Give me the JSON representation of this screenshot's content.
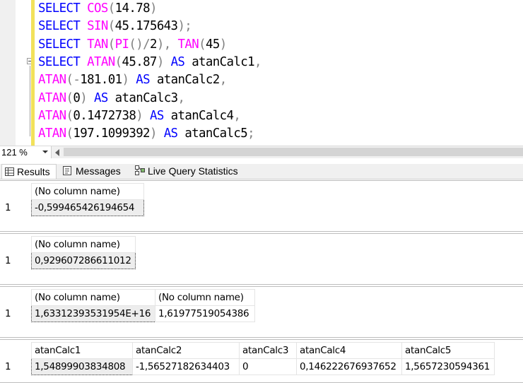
{
  "editor": {
    "lines": [
      [
        {
          "t": "SELECT ",
          "c": "kw"
        },
        {
          "t": "COS",
          "c": "fn"
        },
        {
          "t": "(",
          "c": "op"
        },
        {
          "t": "14.78",
          "c": "tx"
        },
        {
          "t": ")",
          "c": "op"
        }
      ],
      [
        {
          "t": "SELECT ",
          "c": "kw"
        },
        {
          "t": "SIN",
          "c": "fn"
        },
        {
          "t": "(",
          "c": "op"
        },
        {
          "t": "45.175643",
          "c": "tx"
        },
        {
          "t": ");",
          "c": "op"
        }
      ],
      [
        {
          "t": "SELECT ",
          "c": "kw"
        },
        {
          "t": "TAN",
          "c": "fn"
        },
        {
          "t": "(",
          "c": "op"
        },
        {
          "t": "PI",
          "c": "fn"
        },
        {
          "t": "()/",
          "c": "op"
        },
        {
          "t": "2",
          "c": "tx"
        },
        {
          "t": "), ",
          "c": "op"
        },
        {
          "t": "TAN",
          "c": "fn"
        },
        {
          "t": "(",
          "c": "op"
        },
        {
          "t": "45",
          "c": "tx"
        },
        {
          "t": ")",
          "c": "op"
        }
      ],
      [
        {
          "t": "SELECT ",
          "c": "kw"
        },
        {
          "t": "ATAN",
          "c": "fn"
        },
        {
          "t": "(",
          "c": "op"
        },
        {
          "t": "45.87",
          "c": "tx"
        },
        {
          "t": ") ",
          "c": "op"
        },
        {
          "t": "AS ",
          "c": "kw"
        },
        {
          "t": "atanCalc1",
          "c": "tx"
        },
        {
          "t": ",",
          "c": "op"
        }
      ],
      [
        {
          "t": "ATAN",
          "c": "fn"
        },
        {
          "t": "(-",
          "c": "op"
        },
        {
          "t": "181.01",
          "c": "tx"
        },
        {
          "t": ") ",
          "c": "op"
        },
        {
          "t": "AS ",
          "c": "kw"
        },
        {
          "t": "atanCalc2",
          "c": "tx"
        },
        {
          "t": ",",
          "c": "op"
        }
      ],
      [
        {
          "t": "ATAN",
          "c": "fn"
        },
        {
          "t": "(",
          "c": "op"
        },
        {
          "t": "0",
          "c": "tx"
        },
        {
          "t": ") ",
          "c": "op"
        },
        {
          "t": "AS ",
          "c": "kw"
        },
        {
          "t": "atanCalc3",
          "c": "tx"
        },
        {
          "t": ",",
          "c": "op"
        }
      ],
      [
        {
          "t": "ATAN",
          "c": "fn"
        },
        {
          "t": "(",
          "c": "op"
        },
        {
          "t": "0.1472738",
          "c": "tx"
        },
        {
          "t": ") ",
          "c": "op"
        },
        {
          "t": "AS ",
          "c": "kw"
        },
        {
          "t": "atanCalc4",
          "c": "tx"
        },
        {
          "t": ",",
          "c": "op"
        }
      ],
      [
        {
          "t": "ATAN",
          "c": "fn"
        },
        {
          "t": "(",
          "c": "op"
        },
        {
          "t": "197.1099392",
          "c": "tx"
        },
        {
          "t": ") ",
          "c": "op"
        },
        {
          "t": "AS ",
          "c": "kw"
        },
        {
          "t": "atanCalc5",
          "c": "tx"
        },
        {
          "t": ";",
          "c": "op"
        }
      ]
    ]
  },
  "zoom": {
    "value": "121 %"
  },
  "tabs": {
    "results": "Results",
    "messages": "Messages",
    "live": "Live Query Statistics"
  },
  "results": [
    {
      "headers": [
        "(No column name)"
      ],
      "rows": [
        {
          "num": "1",
          "cells": [
            "-0,599465426194654"
          ]
        }
      ]
    },
    {
      "headers": [
        "(No column name)"
      ],
      "rows": [
        {
          "num": "1",
          "cells": [
            "0,929607286611012"
          ]
        }
      ]
    },
    {
      "headers": [
        "(No column name)",
        "(No column name)"
      ],
      "rows": [
        {
          "num": "1",
          "cells": [
            "1,63312393531954E+16",
            "1,61977519054386"
          ]
        }
      ]
    },
    {
      "headers": [
        "atanCalc1",
        "atanCalc2",
        "atanCalc3",
        "atanCalc4",
        "atanCalc5"
      ],
      "rows": [
        {
          "num": "1",
          "cells": [
            "1,54899903834808",
            "-1,56527182634403",
            "0",
            "0,146222676937652",
            "1,5657230594361"
          ]
        }
      ]
    }
  ],
  "colors": {
    "keyword": "#0000ff",
    "function": "#ff00ff",
    "operator": "#808080",
    "changebar": "#f2e15a"
  },
  "icons": {
    "results": "grid-icon",
    "messages": "messages-icon",
    "live": "live-query-icon"
  }
}
